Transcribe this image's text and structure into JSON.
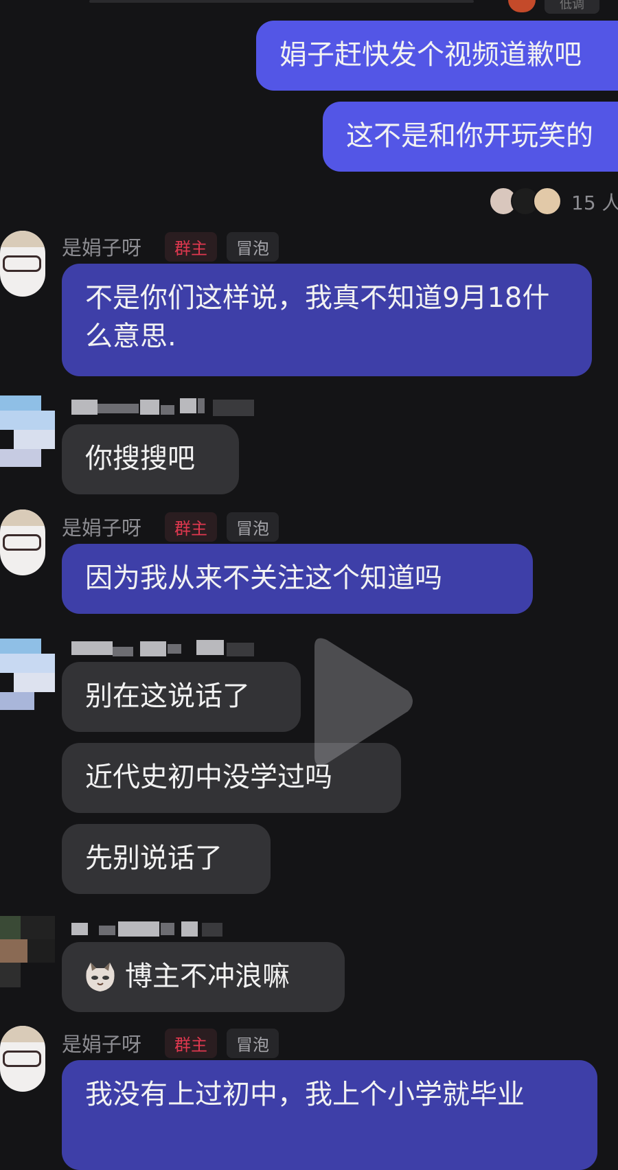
{
  "top_partial_button": "低调",
  "sent_messages": [
    {
      "text": "娟子赶快发个视频道歉吧"
    },
    {
      "text": "这不是和你开玩笑的"
    }
  ],
  "read_receipt": {
    "count_label": "15 人"
  },
  "owner": {
    "name": "是娟子呀",
    "role_badge": "群主",
    "bubble_badge": "冒泡"
  },
  "messages": [
    {
      "sender": "owner",
      "text": "不是你们这样说，我真不知道9月18什么意思."
    },
    {
      "sender": "other1",
      "text": "你搜搜吧"
    },
    {
      "sender": "owner",
      "text": "因为我从来不关注这个知道吗"
    },
    {
      "sender": "other2",
      "text": "别在这说话了"
    },
    {
      "sender": "other2",
      "text": "近代史初中没学过吗"
    },
    {
      "sender": "other2",
      "text": "先别说话了"
    },
    {
      "sender": "other3",
      "text": "博主不冲浪嘛",
      "emoji": "cat-face"
    },
    {
      "sender": "owner",
      "text": "我没有上过初中，我上个小学就毕业"
    }
  ],
  "colors": {
    "background": "#141416",
    "sent_bubble": "#5356e6",
    "owner_bubble": "#3e3fa8",
    "other_bubble": "#333336",
    "owner_badge": "#e0384f"
  }
}
